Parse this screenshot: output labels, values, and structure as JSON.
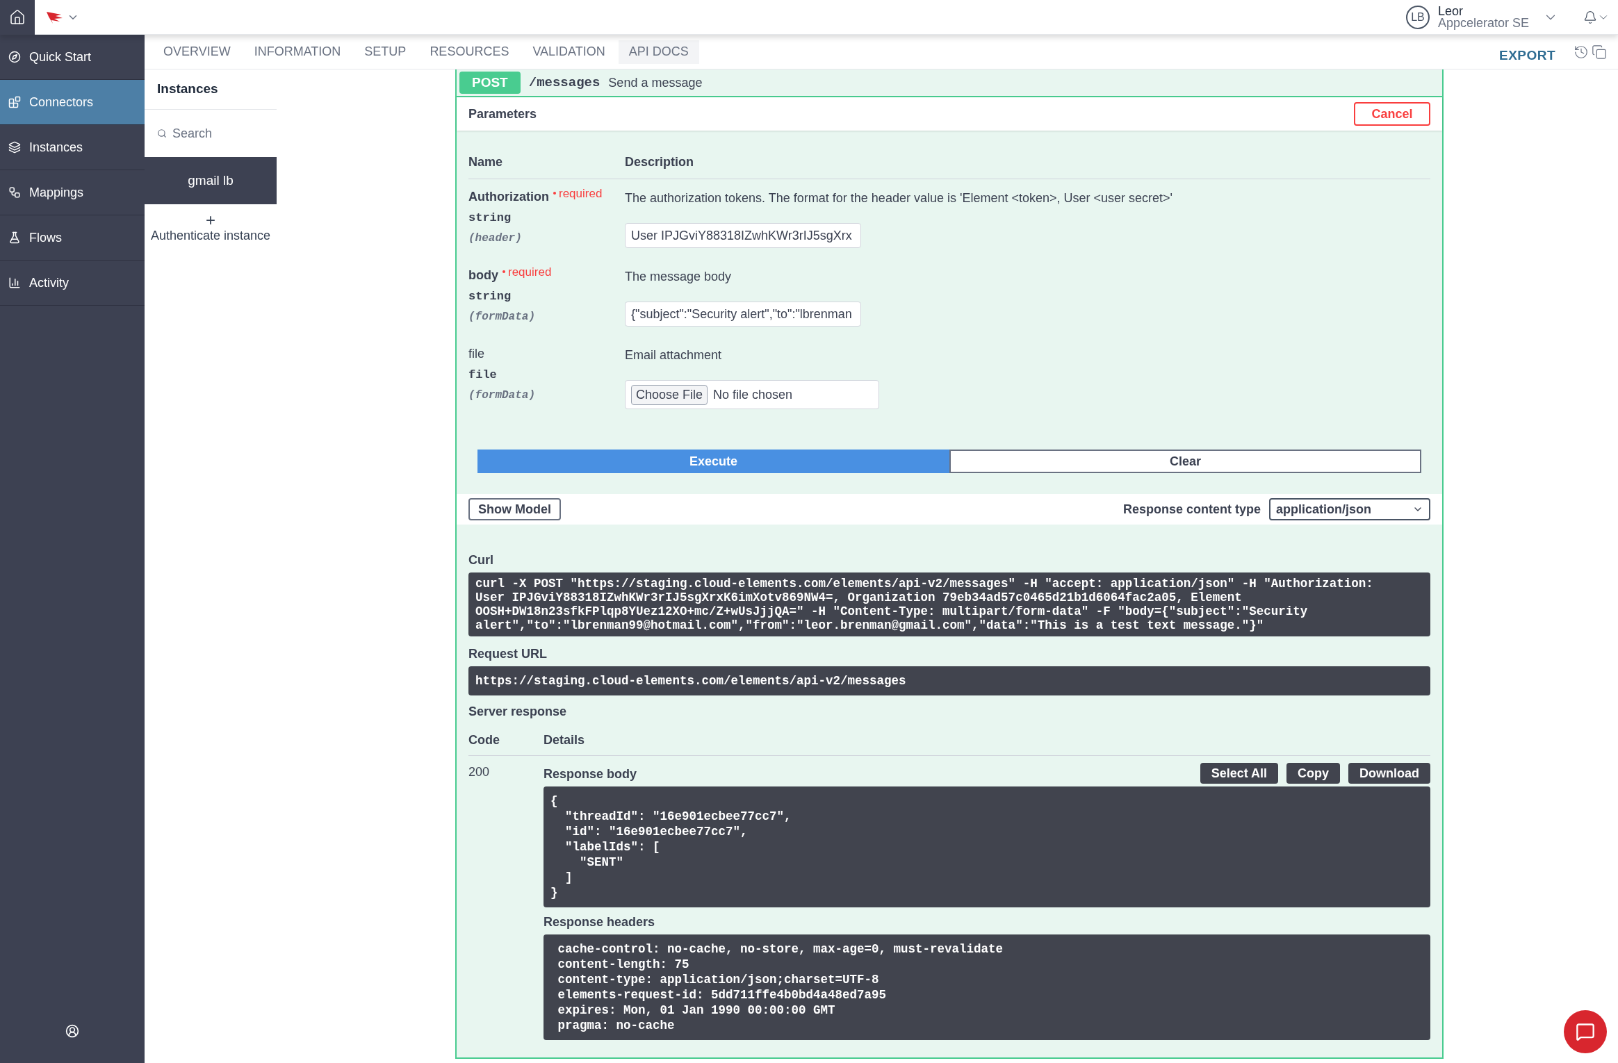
{
  "top_bar": {
    "user": {
      "initials": "LB",
      "name": "Leor",
      "org": "Appcelerator SE"
    }
  },
  "sidebar": {
    "items": [
      {
        "label": "Quick Start",
        "selected": false
      },
      {
        "label": "Connectors",
        "selected": true
      },
      {
        "label": "Instances",
        "selected": false
      },
      {
        "label": "Mappings",
        "selected": false
      },
      {
        "label": "Flows",
        "selected": false
      },
      {
        "label": "Activity",
        "selected": false
      }
    ]
  },
  "tabs": [
    {
      "label": "OVERVIEW",
      "selected": false
    },
    {
      "label": "INFORMATION",
      "selected": false
    },
    {
      "label": "SETUP",
      "selected": false
    },
    {
      "label": "RESOURCES",
      "selected": false
    },
    {
      "label": "VALIDATION",
      "selected": false
    },
    {
      "label": "API DOCS",
      "selected": true
    }
  ],
  "export": "EXPORT",
  "instances_panel": {
    "title": "Instances",
    "search_placeholder": "Search",
    "instances": [
      {
        "name": "gmail lb",
        "selected": true
      }
    ],
    "add": "+",
    "authenticate": "Authenticate instance"
  },
  "operation": {
    "method": "POST",
    "path": "/messages",
    "summary": "Send a message"
  },
  "parameters": {
    "title": "Parameters",
    "cancel": "Cancel",
    "columns": [
      "Name",
      "Description"
    ],
    "rows": [
      {
        "kind": "text",
        "name": "Authorization",
        "required": true,
        "required_label": "required",
        "type": "string",
        "location": "(header)",
        "description": "The authorization tokens. The format for the header value is 'Element <token>, User <user secret>'",
        "value": "User IPJGviY88318IZwhKWr3rIJ5sgXrx"
      },
      {
        "kind": "text",
        "name": "body",
        "required": true,
        "required_label": "required",
        "type": "string",
        "location": "(formData)",
        "description": "The message body",
        "value": "{\"subject\":\"Security alert\",\"to\":\"lbrenman"
      },
      {
        "kind": "file",
        "name": "file",
        "required": false,
        "type": "file",
        "location": "(formData)",
        "description": "Email attachment",
        "button": "Choose File",
        "value": "No file chosen"
      }
    ]
  },
  "actions": {
    "execute": "Execute",
    "clear": "Clear"
  },
  "show_model": "Show Model",
  "response_content_type": {
    "label": "Response content type",
    "value": "application/json"
  },
  "curl": {
    "label": "Curl",
    "lines": [
      "curl -X POST \"https://staging.cloud-elements.com/elements/api-v2/messages\" -H \"accept: application/json\" -H \"Authorization:",
      "User IPJGviY88318IZwhKWr3rIJ5sgXrxK6imXotv869NW4=, Organization 79eb34ad57c0465d21b1d6064fac2a05, Element",
      "OOSH+DW18n23sfkFPlqp8YUez12XO+mc/Z+wUsJjjQA=\" -H \"Content-Type: multipart/form-data\" -F \"body={\"subject\":\"Security",
      "alert\",\"to\":\"lbrenman99@hotmail.com\",\"from\":\"leor.brenman@gmail.com\",\"data\":\"This is a test text message.\"}\""
    ]
  },
  "request_url": {
    "label": "Request URL",
    "value": "https://staging.cloud-elements.com/elements/api-v2/messages"
  },
  "server_response": {
    "title": "Server response",
    "columns": [
      "Code",
      "Details"
    ],
    "code": "200",
    "body_label": "Response body",
    "buttons": [
      "Select All",
      "Copy",
      "Download"
    ],
    "body_lines": [
      "{",
      "  \"threadId\": \"16e901ecbee77cc7\",",
      "  \"id\": \"16e901ecbee77cc7\",",
      "  \"labelIds\": [",
      "    \"SENT\"",
      "  ]",
      "}"
    ],
    "headers_label": "Response headers",
    "header_lines": [
      " cache-control: no-cache, no-store, max-age=0, must-revalidate",
      " content-length: 75",
      " content-type: application/json;charset=UTF-8",
      " elements-request-id: 5dd711ffe4b0bd4a48ed7a95",
      " expires: Mon, 01 Jan 1990 00:00:00 GMT",
      " pragma: no-cache"
    ]
  }
}
